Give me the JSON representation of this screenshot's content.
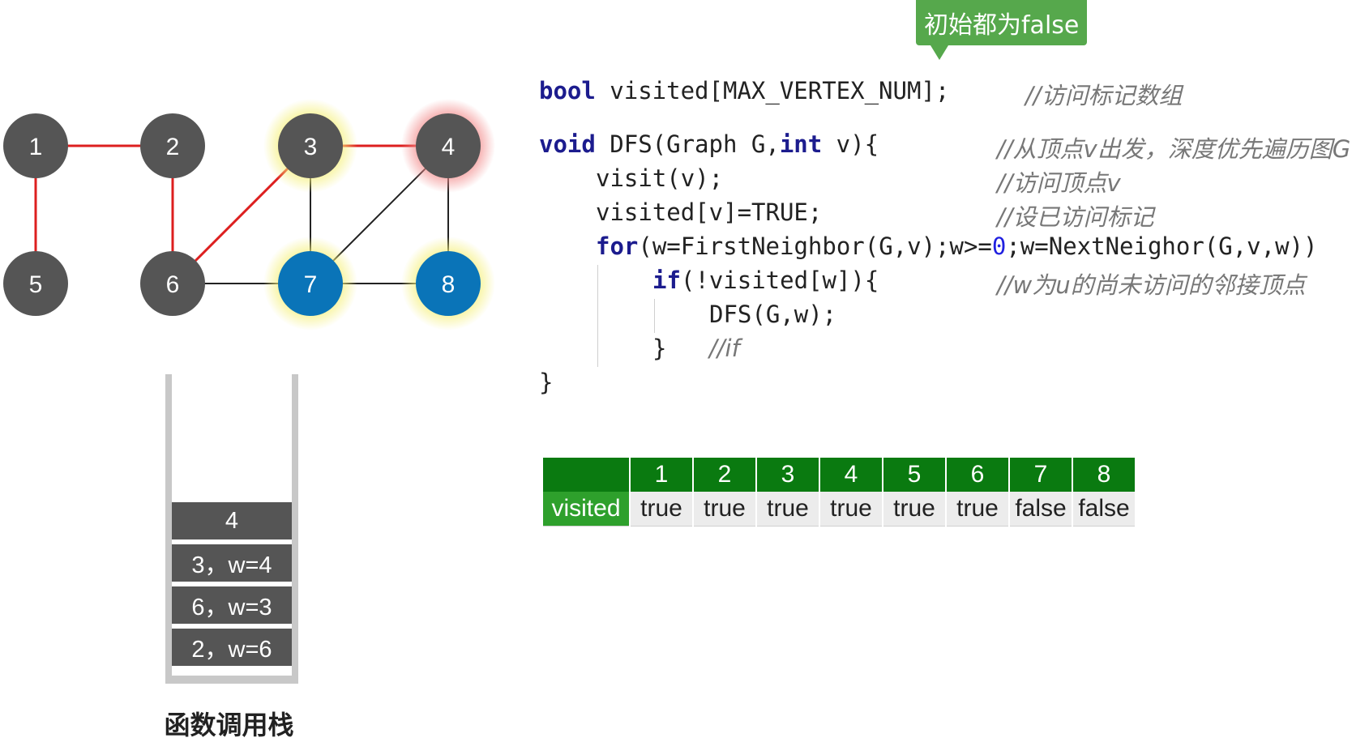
{
  "tooltip": {
    "text": "初始都为false"
  },
  "graph": {
    "nodes": [
      {
        "id": "1",
        "label": "1",
        "fill": "#555555",
        "glow": ""
      },
      {
        "id": "2",
        "label": "2",
        "fill": "#555555",
        "glow": ""
      },
      {
        "id": "3",
        "label": "3",
        "fill": "#555555",
        "glow": "#f5f07a"
      },
      {
        "id": "4",
        "label": "4",
        "fill": "#555555",
        "glow": "#f28a8a"
      },
      {
        "id": "5",
        "label": "5",
        "fill": "#555555",
        "glow": ""
      },
      {
        "id": "6",
        "label": "6",
        "fill": "#555555",
        "glow": ""
      },
      {
        "id": "7",
        "label": "7",
        "fill": "#0a74b8",
        "glow": "#f5f07a"
      },
      {
        "id": "8",
        "label": "8",
        "fill": "#0a74b8",
        "glow": "#f5f07a"
      }
    ],
    "edges": [
      {
        "from": "1",
        "to": "2",
        "color": "#dd1f1f"
      },
      {
        "from": "1",
        "to": "5",
        "color": "#dd1f1f"
      },
      {
        "from": "2",
        "to": "6",
        "color": "#dd1f1f"
      },
      {
        "from": "6",
        "to": "3",
        "color": "#dd1f1f"
      },
      {
        "from": "3",
        "to": "4",
        "color": "#dd1f1f"
      },
      {
        "from": "3",
        "to": "7",
        "color": "#222222"
      },
      {
        "from": "6",
        "to": "7",
        "color": "#222222"
      },
      {
        "from": "7",
        "to": "8",
        "color": "#222222"
      },
      {
        "from": "7",
        "to": "4",
        "color": "#222222"
      },
      {
        "from": "4",
        "to": "8",
        "color": "#222222"
      }
    ]
  },
  "stack": {
    "frames": [
      "4",
      "3，w=4",
      "6，w=3",
      "2，w=6"
    ],
    "caption": "函数调用栈"
  },
  "code": {
    "line1": {
      "kw": "bool",
      "rest": " visited[MAX_VERTEX_NUM];",
      "comment": "//访问标记数组"
    },
    "line2": {
      "kw": "void",
      "mid": " DFS(Graph G,",
      "kw2": "int",
      "rest": " v){",
      "comment": "//从顶点v出发，深度优先遍历图G"
    },
    "line3": {
      "text": "visit(v);",
      "comment": "//访问顶点v"
    },
    "line4": {
      "text": "visited[v]=TRUE;",
      "comment": "//设已访问标记"
    },
    "line5": {
      "kw": "for",
      "mid": "(w=FirstNeighbor(G,v);w>=",
      "num": "0",
      "rest": ";w=NextNeighor(G,v,w))"
    },
    "line6": {
      "kw": "if",
      "rest": "(!visited[w]){",
      "comment": "//w为u的尚未访问的邻接顶点"
    },
    "line7": {
      "text": "DFS(G,w);"
    },
    "line8": {
      "text": "}",
      "comment": "//if"
    },
    "line9": {
      "text": "}"
    }
  },
  "visited_table": {
    "row_label": "visited",
    "headers": [
      "1",
      "2",
      "3",
      "4",
      "5",
      "6",
      "7",
      "8"
    ],
    "values": [
      "true",
      "true",
      "true",
      "true",
      "true",
      "true",
      "false",
      "false"
    ]
  }
}
